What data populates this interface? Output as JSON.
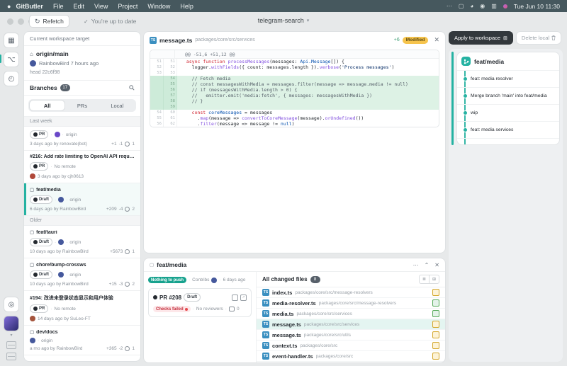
{
  "menu_bar": {
    "items": [
      "GitButler",
      "File",
      "Edit",
      "View",
      "Project",
      "Window",
      "Help"
    ],
    "clock": "Tue Jun 10 11:30"
  },
  "toolbar": {
    "refetch": "Refetch",
    "status": "You're up to date",
    "project": "telegram-search"
  },
  "sidebar": {
    "workspace_header": "Current workspace target",
    "target_branch": "origin/main",
    "target_author": "RainbowBird 7 hours ago",
    "target_head": "head 22c6f98",
    "branches_label": "Branches",
    "branches_count": "17",
    "tabs": [
      {
        "label": "All",
        "selected": true
      },
      {
        "label": "PRs"
      },
      {
        "label": "Local"
      }
    ],
    "sections": [
      {
        "label": "Last week",
        "items": [
          {
            "pill": "PR",
            "avatar": "#6a48c8",
            "remote": "origin",
            "meta": "3 days ago by renovate(bot)",
            "add": "+1",
            "del": "-1",
            "commits": "1"
          },
          {
            "title": "#216: Add rate limiting to OpenAI API requests",
            "pill": "PR",
            "remote": "No remote",
            "meta_avatar": "#b0483a",
            "meta": "3 days ago by cjh0613"
          },
          {
            "title": "feat/media",
            "title_icon": true,
            "pill": "Draft",
            "avatar": "#45589c",
            "remote": "origin",
            "meta": "6 days ago by RainbowBird",
            "add": "+209",
            "del": "-4",
            "commits": "2",
            "selected": true
          }
        ]
      },
      {
        "label": "Older",
        "items": [
          {
            "title": "feat/tauri",
            "title_icon": true,
            "pill": "Draft",
            "avatar": "#45589c",
            "remote": "origin",
            "meta": "10 days ago by RainbowBird",
            "add": "+5673",
            "commits": "1"
          },
          {
            "title": "chore/bump-crossws",
            "title_icon": true,
            "pill": "Draft",
            "avatar": "#45589c",
            "remote": "origin",
            "meta": "10 days ago by RainbowBird",
            "add": "+15",
            "del": "-3",
            "commits": "2"
          },
          {
            "title": "#194: 改进未登录状态显示和用户体验",
            "pill": "PR",
            "remote": "No remote",
            "meta_avatar": "#a4543c",
            "meta": "14 days ago by SuLeo-FT"
          },
          {
            "title": "dev/docs",
            "title_icon": true,
            "avatar": "#45589c",
            "remote": "origin",
            "meta": "a mo ago by RainbowBird",
            "add": "+365",
            "del": "-2",
            "commits": "1"
          }
        ]
      }
    ]
  },
  "diff": {
    "file_name": "message.ts",
    "file_path": "packages/core/src/services",
    "added_count": "+6",
    "status": "Modified",
    "hunk": "@@ -51,6 +51,12 @@",
    "lines": [
      {
        "o": "51",
        "n": "51",
        "t": "ctx",
        "seg": [
          [
            "d",
            "  "
          ],
          [
            "k",
            "async"
          ],
          [
            "d",
            " "
          ],
          [
            "k",
            "function"
          ],
          [
            "d",
            " "
          ],
          [
            "f",
            "processMessages"
          ],
          [
            "d",
            "("
          ],
          [
            "d",
            "messages"
          ],
          [
            "d",
            ": "
          ],
          [
            "n",
            "Api.Message"
          ],
          [
            "d",
            "[]) {"
          ]
        ]
      },
      {
        "o": "52",
        "n": "52",
        "t": "ctx",
        "seg": [
          [
            "d",
            "    logger."
          ],
          [
            "f",
            "withFields"
          ],
          [
            "d",
            "({ count: messages.length })."
          ],
          [
            "f",
            "verbose"
          ],
          [
            "d",
            "("
          ],
          [
            "s",
            "'Process messages'"
          ],
          [
            "d",
            ")"
          ]
        ]
      },
      {
        "o": "53",
        "n": "53",
        "t": "ctx",
        "seg": []
      },
      {
        "o": "",
        "n": "54",
        "t": "add",
        "seg": [
          [
            "c",
            "    // Fetch media"
          ]
        ]
      },
      {
        "o": "",
        "n": "55",
        "t": "add",
        "seg": [
          [
            "c",
            "    // const messagesWithMedia = messages.filter(message => message.media != null)"
          ]
        ]
      },
      {
        "o": "",
        "n": "56",
        "t": "add",
        "seg": [
          [
            "c",
            "    // if (messagesWithMedia.length > 0) {"
          ]
        ]
      },
      {
        "o": "",
        "n": "57",
        "t": "add",
        "seg": [
          [
            "c",
            "    //   emitter.emit('media:fetch', { messages: messagesWithMedia })"
          ]
        ]
      },
      {
        "o": "",
        "n": "58",
        "t": "add",
        "seg": [
          [
            "c",
            "    // }"
          ]
        ]
      },
      {
        "o": "",
        "n": "59",
        "t": "add",
        "seg": []
      },
      {
        "o": "54",
        "n": "60",
        "t": "ctx",
        "seg": [
          [
            "d",
            "    "
          ],
          [
            "k",
            "const"
          ],
          [
            "d",
            " "
          ],
          [
            "n",
            "coreMessages"
          ],
          [
            "d",
            " = messages"
          ]
        ]
      },
      {
        "o": "55",
        "n": "61",
        "t": "ctx",
        "seg": [
          [
            "d",
            "      ."
          ],
          [
            "f",
            "map"
          ],
          [
            "d",
            "(message => "
          ],
          [
            "f",
            "convertToCoreMessage"
          ],
          [
            "d",
            "(message)."
          ],
          [
            "f",
            "orUndefined"
          ],
          [
            "d",
            "())"
          ]
        ]
      },
      {
        "o": "56",
        "n": "62",
        "t": "ctx",
        "seg": [
          [
            "d",
            "      ."
          ],
          [
            "f",
            "filter"
          ],
          [
            "d",
            "(message => message != "
          ],
          [
            "n",
            "null"
          ],
          [
            "d",
            ")"
          ]
        ]
      }
    ]
  },
  "branch_panel": {
    "title": "feat/media",
    "push_pill": "Nothing to push",
    "contribs": "Contribs",
    "age": "6 days ago",
    "pr_label": "PR #208",
    "pr_badge": "Draft",
    "checks": "Checks failed",
    "reviewers": "No reviewers",
    "comments": "0",
    "files_header": "All changed files",
    "files_count": "8",
    "files": [
      {
        "name": "index.ts",
        "path": "packages/core/src/message-resolvers",
        "status": "M"
      },
      {
        "name": "media-resolver.ts",
        "path": "packages/core/src/message-resolvers",
        "status": "A"
      },
      {
        "name": "media.ts",
        "path": "packages/core/src/services",
        "status": "A"
      },
      {
        "name": "message.ts",
        "path": "packages/core/src/services",
        "status": "M",
        "selected": true
      },
      {
        "name": "message.ts",
        "path": "packages/core/src/utils",
        "status": "M"
      },
      {
        "name": "context.ts",
        "path": "packages/core/src",
        "status": "M"
      },
      {
        "name": "event-handler.ts",
        "path": "packages/core/src",
        "status": "M"
      }
    ]
  },
  "right_panel": {
    "apply_label": "Apply to workspace",
    "delete_label": "Delete local",
    "branch": "feat/media",
    "commits": [
      "feat: media resolver",
      "Merge branch 'main' into feat/media",
      "wip",
      "feat: media services"
    ]
  },
  "colors": {
    "accent_teal": "#25b2a2",
    "modified_yellow": "#f6c44d",
    "added_green": "#57ab5a",
    "failed_red": "#c5303e",
    "menubar": "#46585e"
  }
}
